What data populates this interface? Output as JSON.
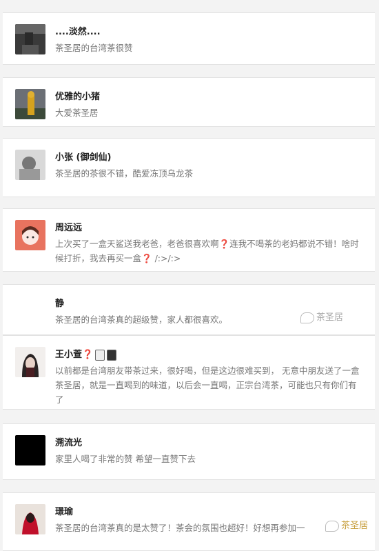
{
  "comments": [
    {
      "name": "....淡然....",
      "text": "茶圣居的台湾茶很赞"
    },
    {
      "name": "优雅的小猪",
      "text": "大爱茶圣居"
    },
    {
      "name": "小张 (御剑仙)",
      "text": "茶圣居的茶很不错，酷爱冻顶乌龙茶"
    },
    {
      "name": "周远远",
      "text_a": "上次买了一盒天鲨送我老爸，老爸很喜欢啊",
      "text_b": "连我不喝茶的老妈都说不错！啥时候打折，我去再买一盒",
      "text_c": " /:>/:>"
    },
    {
      "name": "静",
      "text": "茶圣居的台湾茶真的超级赞，家人都很喜欢。"
    },
    {
      "name": "王小萱",
      "text": "以前都是台湾朋友带茶过来，很好喝，但是这边很难买到， 无意中朋友送了一盒茶圣居，就是一直喝到的味道，以后会一直喝，正宗台湾茶，可能也只有你们有了"
    },
    {
      "name": "溯流光",
      "text": "家里人喝了非常的赞 希望一直赞下去"
    },
    {
      "name": "璟瑜",
      "text": "茶圣居的台湾茶真的是太赞了！茶会的氛围也超好！好想再参加一"
    }
  ],
  "watermark": "茶圣居",
  "question_mark": "❓",
  "colors": {
    "question": "#d9302e",
    "text": "#777777",
    "name": "#222222"
  }
}
